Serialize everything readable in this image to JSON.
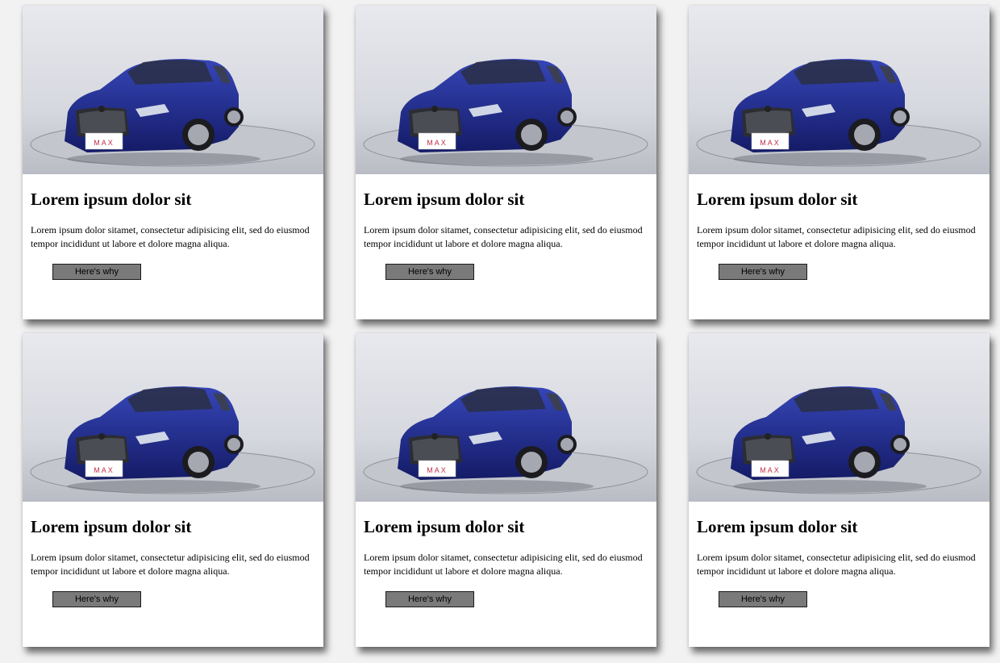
{
  "cards": [
    {
      "title": "Lorem ipsum dolor sit",
      "text": "Lorem ipsum dolor sitamet, consectetur adipisicing elit, sed do eiusmod tempor incididunt ut labore et dolore magna aliqua.",
      "button_label": "Here's why",
      "plate_text": "MAX"
    },
    {
      "title": "Lorem ipsum dolor sit",
      "text": "Lorem ipsum dolor sitamet, consectetur adipisicing elit, sed do eiusmod tempor incididunt ut labore et dolore magna aliqua.",
      "button_label": "Here's why",
      "plate_text": "MAX"
    },
    {
      "title": "Lorem ipsum dolor sit",
      "text": "Lorem ipsum dolor sitamet, consectetur adipisicing elit, sed do eiusmod tempor incididunt ut labore et dolore magna aliqua.",
      "button_label": "Here's why",
      "plate_text": "MAX"
    },
    {
      "title": "Lorem ipsum dolor sit",
      "text": "Lorem ipsum dolor sitamet, consectetur adipisicing elit, sed do eiusmod tempor incididunt ut labore et dolore magna aliqua.",
      "button_label": "Here's why",
      "plate_text": "MAX"
    },
    {
      "title": "Lorem ipsum dolor sit",
      "text": "Lorem ipsum dolor sitamet, consectetur adipisicing elit, sed do eiusmod tempor incididunt ut labore et dolore magna aliqua.",
      "button_label": "Here's why",
      "plate_text": "MAX"
    },
    {
      "title": "Lorem ipsum dolor sit",
      "text": "Lorem ipsum dolor sitamet, consectetur adipisicing elit, sed do eiusmod tempor incididunt ut labore et dolore magna aliqua.",
      "button_label": "Here's why",
      "plate_text": "MAX"
    }
  ],
  "colors": {
    "car_body": "#1f2a8a",
    "studio_bg": "#dfe0e6",
    "button_bg": "#7a7a7a"
  }
}
